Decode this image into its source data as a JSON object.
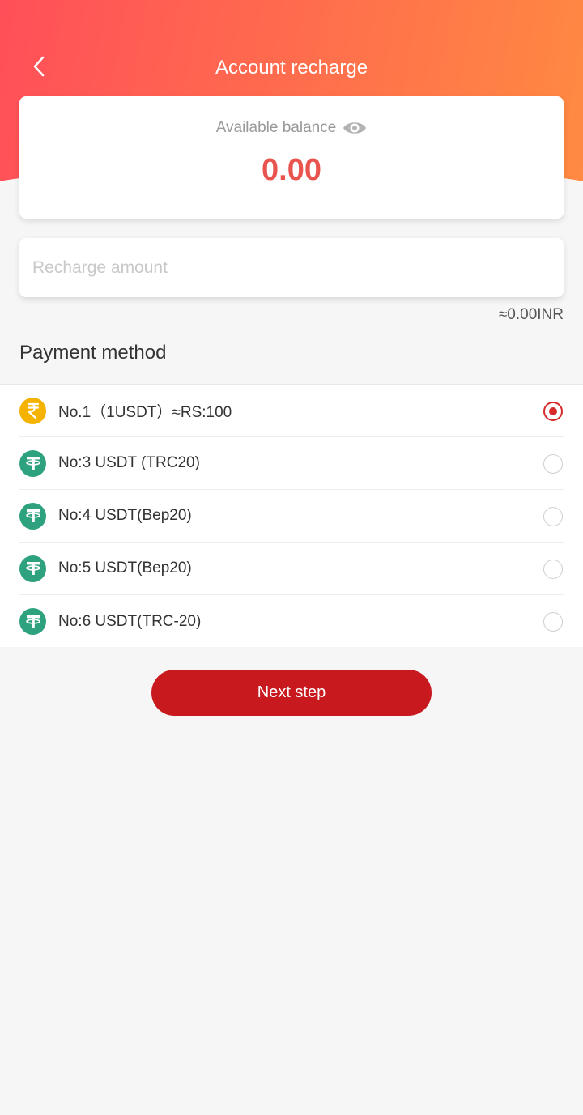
{
  "header": {
    "title": "Account recharge",
    "gradient_start": "#ff4f59",
    "gradient_end": "#ff8a42"
  },
  "balance": {
    "label": "Available balance",
    "value": "0.00",
    "value_color": "#e9544f"
  },
  "recharge": {
    "placeholder": "Recharge amount",
    "value": "",
    "converted": "≈0.00INR"
  },
  "payment": {
    "title": "Payment method",
    "accent": "#d72a2a",
    "methods": [
      {
        "label": "No.1（1USDT）≈RS:100",
        "icon": "rupee-coin-icon",
        "selected": true
      },
      {
        "label": "No:3 USDT (TRC20)",
        "icon": "tether-icon",
        "selected": false
      },
      {
        "label": "No:4 USDT(Bep20)",
        "icon": "tether-icon",
        "selected": false
      },
      {
        "label": "No:5 USDT(Bep20)",
        "icon": "tether-icon",
        "selected": false
      },
      {
        "label": "No:6 USDT(TRC-20)",
        "icon": "tether-icon",
        "selected": false
      }
    ]
  },
  "actions": {
    "next_label": "Next step",
    "button_color": "#c7191e"
  }
}
